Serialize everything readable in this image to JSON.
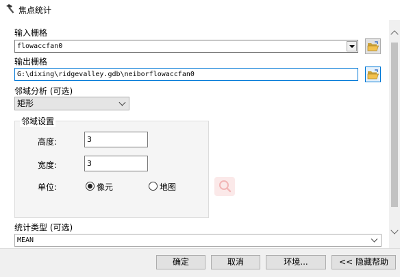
{
  "window": {
    "title": "焦点统计"
  },
  "input_raster": {
    "label": "输入栅格",
    "value": "flowaccfan0"
  },
  "output_raster": {
    "label": "输出栅格",
    "value": "G:\\dixing\\ridgevalley.gdb\\neiborflowaccfan0"
  },
  "neighborhood": {
    "label": "邻域分析 (可选)",
    "value": "矩形"
  },
  "neighborhood_settings": {
    "title": "邻域设置",
    "height_label": "高度:",
    "height_value": "3",
    "width_label": "宽度:",
    "width_value": "3",
    "units_label": "单位:",
    "unit_options": [
      {
        "label": "像元",
        "selected": true
      },
      {
        "label": "地图",
        "selected": false
      }
    ]
  },
  "statistics_type": {
    "label": "统计类型 (可选)",
    "value": "MEAN"
  },
  "buttons": {
    "ok": "确定",
    "cancel": "取消",
    "environments": "环境...",
    "hide_help": "<< 隐藏帮助"
  },
  "icons": {
    "title": "hammer-icon",
    "browse": "folder-open-icon",
    "help": "magnifier-icon"
  },
  "colors": {
    "focus_border": "#0078d7",
    "folder_yellow": "#f2c14e",
    "help_icon_tint": "#f2b6b6"
  }
}
